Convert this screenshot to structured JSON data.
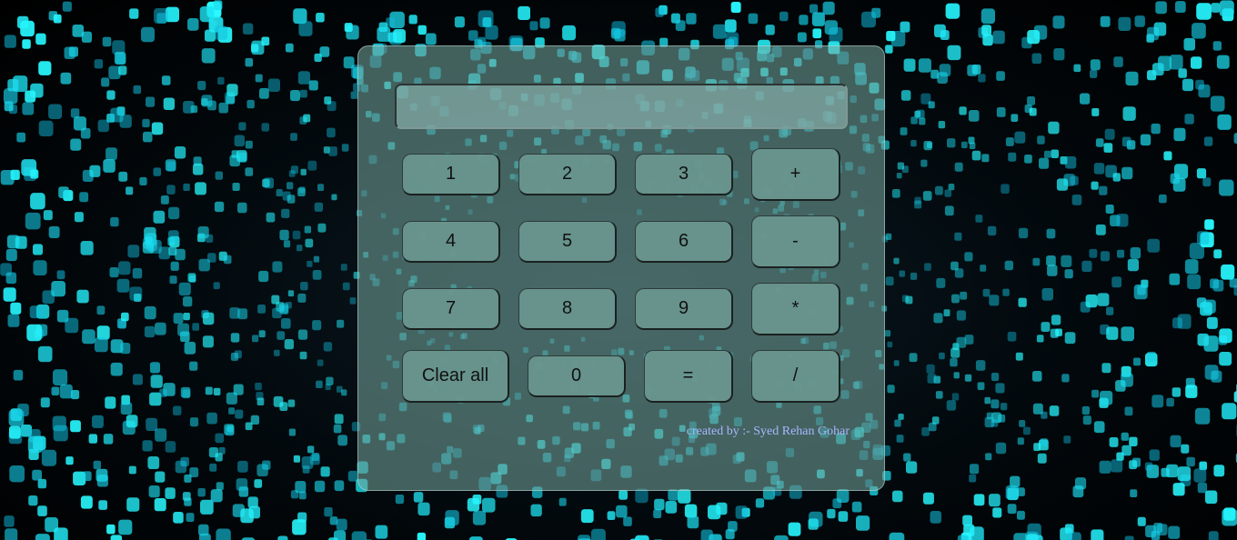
{
  "display": {
    "value": "",
    "placeholder": ""
  },
  "buttons": {
    "row1": [
      "1",
      "2",
      "3",
      "+"
    ],
    "row2": [
      "4",
      "5",
      "6",
      "-"
    ],
    "row3": [
      "7",
      "8",
      "9",
      "*"
    ],
    "row4": [
      "Clear all",
      "0",
      "=",
      "/"
    ]
  },
  "credit": "created by :- Syed Rehan Gohar",
  "colors": {
    "panel": "#78aaa0",
    "button": "#69968e",
    "credit_text": "#a9b6ff",
    "background_glow": "#3fe0ff"
  }
}
